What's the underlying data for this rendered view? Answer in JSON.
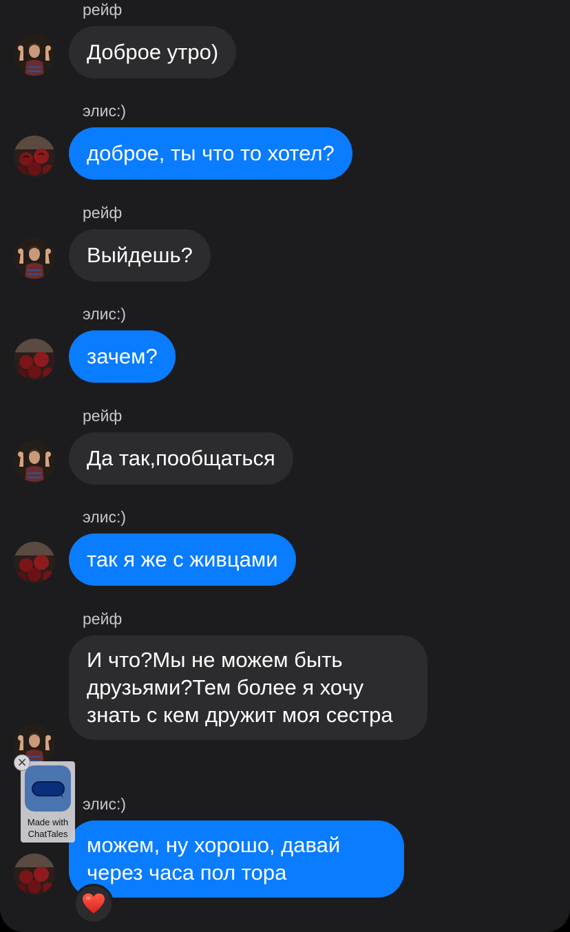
{
  "colors": {
    "background": "#1c1c1e",
    "incoming_bubble": "#2c2c2e",
    "outgoing_bubble": "#0a7cff",
    "sender_text": "#c7c7cc"
  },
  "messages": [
    {
      "sender": "рейф",
      "text": "Доброе утро)",
      "style": "incoming",
      "avatar": "reif-avatar"
    },
    {
      "sender": "элис:)",
      "text": "доброе, ты что то хотел?",
      "style": "outgoing",
      "avatar": "rose-avatar"
    },
    {
      "sender": "рейф",
      "text": "Выйдешь?",
      "style": "incoming",
      "avatar": "reif-avatar"
    },
    {
      "sender": "элис:)",
      "text": "зачем?",
      "style": "outgoing",
      "avatar": "rose-avatar"
    },
    {
      "sender": "рейф",
      "text": "Да так,пообщаться",
      "style": "incoming",
      "avatar": "reif-avatar"
    },
    {
      "sender": "элис:)",
      "text": "так я же с живцами",
      "style": "outgoing",
      "avatar": "rose-avatar"
    },
    {
      "sender": "рейф",
      "text": "И что?Мы не можем быть друзьями?Тем более я хочу знать с кем дружит моя сестра",
      "style": "incoming",
      "avatar": "reif-avatar"
    },
    {
      "sender": "элис:)",
      "text": "можем, ну хорошо, давай через часа пол тора",
      "style": "outgoing",
      "avatar": "rose-avatar",
      "reaction": "heart-icon"
    }
  ],
  "watermark": {
    "line1": "Made with",
    "line2": "ChatTales"
  }
}
